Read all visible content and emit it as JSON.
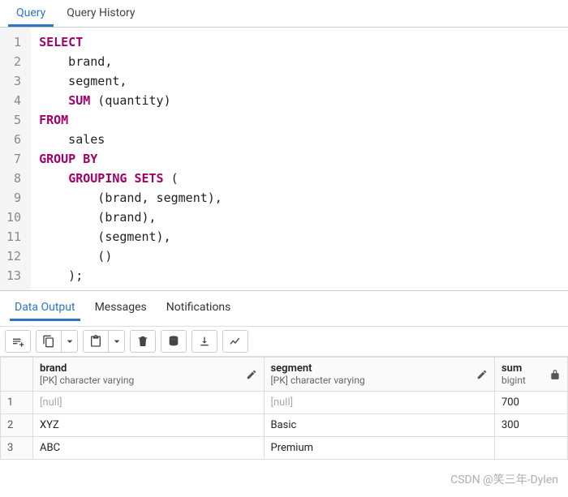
{
  "topTabs": {
    "query": "Query",
    "history": "Query History"
  },
  "code": {
    "lines": [
      "1",
      "2",
      "3",
      "4",
      "5",
      "6",
      "7",
      "8",
      "9",
      "10",
      "11",
      "12",
      "13"
    ],
    "l1_kw": "SELECT",
    "l2": "    brand,",
    "l3": "    segment,",
    "l4_indent": "    ",
    "l4_fn": "SUM",
    "l4_rest": " (quantity)",
    "l5_kw": "FROM",
    "l6": "    sales",
    "l7_kw": "GROUP BY",
    "l8_indent": "    ",
    "l8_kw": "GROUPING SETS",
    "l8_rest": " (",
    "l9": "        (brand, segment),",
    "l10": "        (brand),",
    "l11": "        (segment),",
    "l12": "        ()",
    "l13": "    );"
  },
  "outTabs": {
    "data": "Data Output",
    "messages": "Messages",
    "notifications": "Notifications"
  },
  "columns": {
    "brand": {
      "name": "brand",
      "type": "[PK] character varying"
    },
    "segment": {
      "name": "segment",
      "type": "[PK] character varying"
    },
    "sum": {
      "name": "sum",
      "type": "bigint"
    }
  },
  "rows": [
    {
      "n": "1",
      "brand": "[null]",
      "segment": "[null]",
      "sum": "700"
    },
    {
      "n": "2",
      "brand": "XYZ",
      "segment": "Basic",
      "sum": "300"
    },
    {
      "n": "3",
      "brand": "ABC",
      "segment": "Premium",
      "sum": ""
    }
  ],
  "watermark": "CSDN @笑三年-Dylen"
}
